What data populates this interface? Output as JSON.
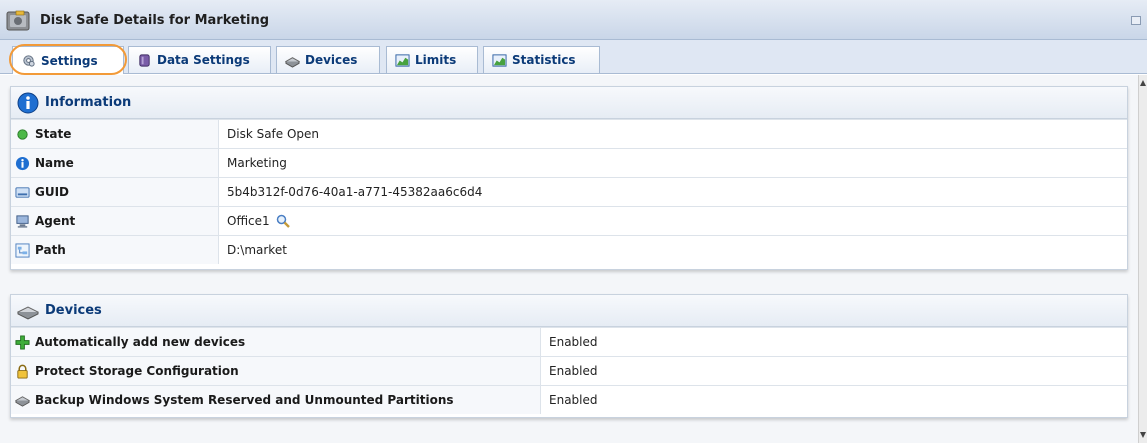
{
  "window": {
    "title": "Disk Safe Details for Marketing"
  },
  "tabs": [
    {
      "label": "Settings",
      "icon": "gear-icon"
    },
    {
      "label": "Data Settings",
      "icon": "database-icon"
    },
    {
      "label": "Devices",
      "icon": "disk-icon"
    },
    {
      "label": "Limits",
      "icon": "chart-icon"
    },
    {
      "label": "Statistics",
      "icon": "chart-icon"
    }
  ],
  "active_tab": "Settings",
  "information": {
    "title": "Information",
    "rows": [
      {
        "label": "State",
        "value": "Disk Safe Open",
        "icon": "status-green-icon"
      },
      {
        "label": "Name",
        "value": "Marketing",
        "icon": "info-icon"
      },
      {
        "label": "GUID",
        "value": "5b4b312f-0d76-40a1-a771-45382aa6c6d4",
        "icon": "drive-icon"
      },
      {
        "label": "Agent",
        "value": "Office1",
        "icon": "computer-icon"
      },
      {
        "label": "Path",
        "value": "D:\\market",
        "icon": "folder-tree-icon"
      }
    ]
  },
  "devices": {
    "title": "Devices",
    "rows": [
      {
        "label": "Automatically add new devices",
        "value": "Enabled",
        "icon": "add-icon"
      },
      {
        "label": "Protect Storage Configuration",
        "value": "Enabled",
        "icon": "lock-icon"
      },
      {
        "label": "Backup Windows System Reserved and Unmounted Partitions",
        "value": "Enabled",
        "icon": "disk-icon"
      }
    ]
  },
  "colors": {
    "accent": "#0b3a78",
    "highlight": "#f29a38",
    "header_bg": "#dfe7f3"
  }
}
